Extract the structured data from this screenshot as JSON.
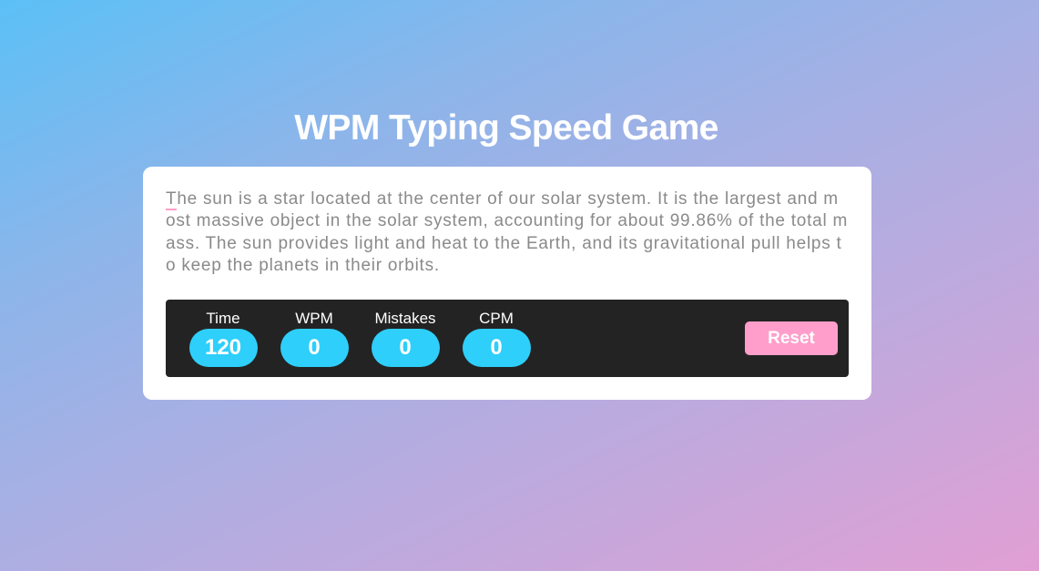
{
  "header": {
    "title": "WPM Typing Speed Game"
  },
  "passage": {
    "first_char": "T",
    "rest": "he sun is a star located at the center of our solar system. It is the largest and most massive object in the solar system, accounting for about 99.86% of the total mass. The sun provides light and heat to the Earth, and its gravitational pull helps to keep the planets in their orbits.",
    "placeholder": ""
  },
  "stats": {
    "time_label": "Time",
    "time_value": "120",
    "wpm_label": "WPM",
    "wpm_value": "0",
    "mistakes_label": "Mistakes",
    "mistakes_value": "0",
    "cpm_label": "CPM",
    "cpm_value": "0"
  },
  "controls": {
    "reset_label": "Reset"
  },
  "colors": {
    "accent_blue": "#2ecffa",
    "accent_pink": "#ff9ecb",
    "bar_background": "#232323",
    "text_gray": "#8a8a8a"
  }
}
